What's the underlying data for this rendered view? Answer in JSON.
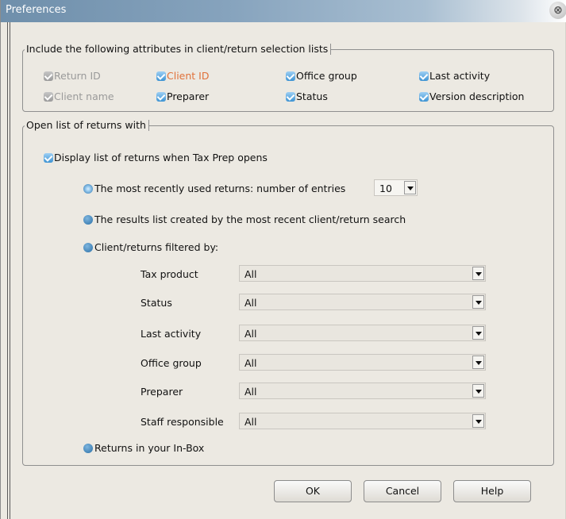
{
  "window": {
    "title": "Preferences",
    "close_symbol": "⊗"
  },
  "attributes": {
    "legend": "Include the following attributes in client/return selection lists",
    "items": [
      {
        "label": "Return ID",
        "checked": true,
        "enabled": false
      },
      {
        "label": "Client ID",
        "checked": true,
        "enabled": true
      },
      {
        "label": "Office group",
        "checked": true,
        "enabled": true
      },
      {
        "label": "Last activity",
        "checked": true,
        "enabled": true
      },
      {
        "label": "Client name",
        "checked": true,
        "enabled": false
      },
      {
        "label": "Preparer",
        "checked": true,
        "enabled": true
      },
      {
        "label": "Status",
        "checked": true,
        "enabled": true
      },
      {
        "label": "Version description",
        "checked": true,
        "enabled": true
      }
    ]
  },
  "open_list": {
    "legend": "Open list of returns with",
    "display_label": "Display list of returns when Tax Prep opens",
    "recent": {
      "label": "The most recently used returns:  number of entries",
      "entries_value": "10"
    },
    "results_label": "The results list created by the most recent client/return search",
    "filtered_label": "Client/returns filtered by:",
    "filters": [
      {
        "label": "Tax product",
        "value": "All"
      },
      {
        "label": "Status",
        "value": "All"
      },
      {
        "label": "Last activity",
        "value": "All"
      },
      {
        "label": "Office group",
        "value": "All"
      },
      {
        "label": "Preparer",
        "value": "All"
      },
      {
        "label": "Staff responsible",
        "value": "All"
      }
    ],
    "inbox_label": "Returns in your In-Box"
  },
  "buttons": {
    "ok": "OK",
    "cancel": "Cancel",
    "help": "Help"
  }
}
